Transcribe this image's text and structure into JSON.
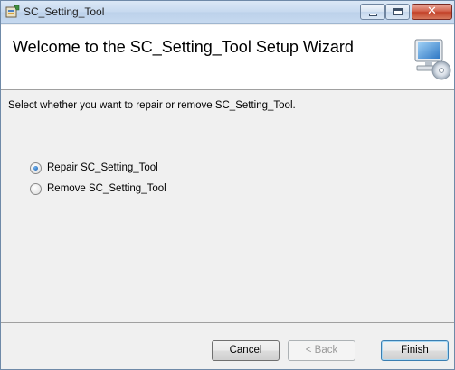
{
  "window": {
    "title": "SC_Setting_Tool",
    "close_symbol": "✕"
  },
  "banner": {
    "title": "Welcome to the SC_Setting_Tool Setup Wizard",
    "icon": "computer-cd-icon"
  },
  "content": {
    "instruction": "Select whether you want to repair or remove SC_Setting_Tool.",
    "options": [
      {
        "label": "Repair SC_Setting_Tool",
        "selected": true
      },
      {
        "label": "Remove SC_Setting_Tool",
        "selected": false
      }
    ]
  },
  "buttons": {
    "cancel": "Cancel",
    "back": "< Back",
    "finish": "Finish"
  },
  "colors": {
    "window_bg": "#f0f0f0",
    "banner_bg": "#ffffff",
    "close_button": "#c24229"
  }
}
